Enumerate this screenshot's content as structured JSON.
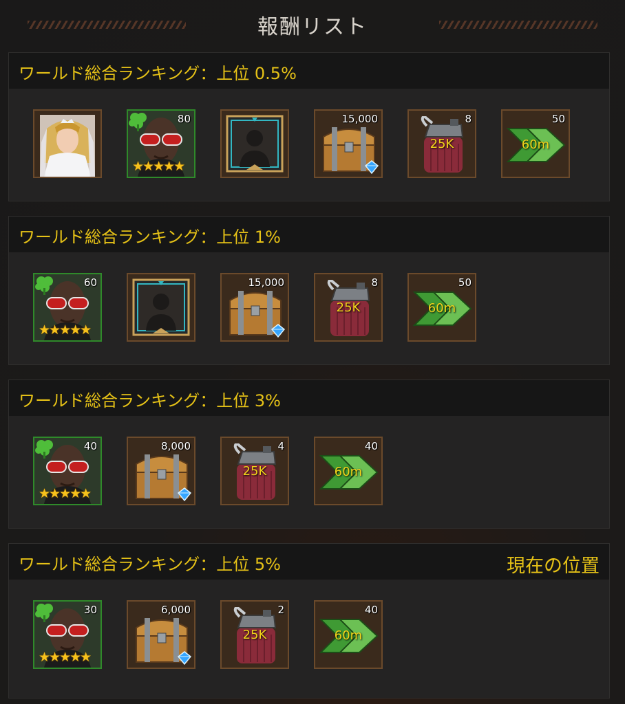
{
  "header": {
    "title": "報酬リスト"
  },
  "colors": {
    "accent_gold": "#e6c217",
    "panel": "#242323",
    "header": "#161616",
    "green_border": "#2f8a2a",
    "brown_border": "#6b4a2b"
  },
  "sections": [
    {
      "title": "ワールド総合ランキング：上位 0.5%",
      "position_label": "",
      "items": [
        {
          "type": "portrait",
          "icon": "bride-portrait-icon",
          "qty": ""
        },
        {
          "type": "hero",
          "icon": "hero-card-icon",
          "qty": "80",
          "stars": "★★★★★"
        },
        {
          "type": "frame",
          "icon": "avatar-frame-icon",
          "qty": ""
        },
        {
          "type": "chest",
          "icon": "treasure-chest-icon",
          "qty": "15,000"
        },
        {
          "type": "fuel",
          "icon": "fuel-can-icon",
          "qty": "8",
          "label": "25K"
        },
        {
          "type": "speedup",
          "icon": "speedup-arrows-icon",
          "qty": "50",
          "label": "60m"
        }
      ]
    },
    {
      "title": "ワールド総合ランキング：上位 1%",
      "position_label": "",
      "items": [
        {
          "type": "hero",
          "icon": "hero-card-icon",
          "qty": "60",
          "stars": "★★★★★"
        },
        {
          "type": "frame",
          "icon": "avatar-frame-icon",
          "qty": ""
        },
        {
          "type": "chest",
          "icon": "treasure-chest-icon",
          "qty": "15,000"
        },
        {
          "type": "fuel",
          "icon": "fuel-can-icon",
          "qty": "8",
          "label": "25K"
        },
        {
          "type": "speedup",
          "icon": "speedup-arrows-icon",
          "qty": "50",
          "label": "60m"
        }
      ]
    },
    {
      "title": "ワールド総合ランキング：上位 3%",
      "position_label": "",
      "items": [
        {
          "type": "hero",
          "icon": "hero-card-icon",
          "qty": "40",
          "stars": "★★★★★"
        },
        {
          "type": "chest",
          "icon": "treasure-chest-icon",
          "qty": "8,000"
        },
        {
          "type": "fuel",
          "icon": "fuel-can-icon",
          "qty": "4",
          "label": "25K"
        },
        {
          "type": "speedup",
          "icon": "speedup-arrows-icon",
          "qty": "40",
          "label": "60m"
        }
      ]
    },
    {
      "title": "ワールド総合ランキング：上位 5%",
      "position_label": "現在の位置",
      "items": [
        {
          "type": "hero",
          "icon": "hero-card-icon",
          "qty": "30",
          "stars": "★★★★★"
        },
        {
          "type": "chest",
          "icon": "treasure-chest-icon",
          "qty": "6,000"
        },
        {
          "type": "fuel",
          "icon": "fuel-can-icon",
          "qty": "2",
          "label": "25K"
        },
        {
          "type": "speedup",
          "icon": "speedup-arrows-icon",
          "qty": "40",
          "label": "60m"
        }
      ]
    }
  ]
}
